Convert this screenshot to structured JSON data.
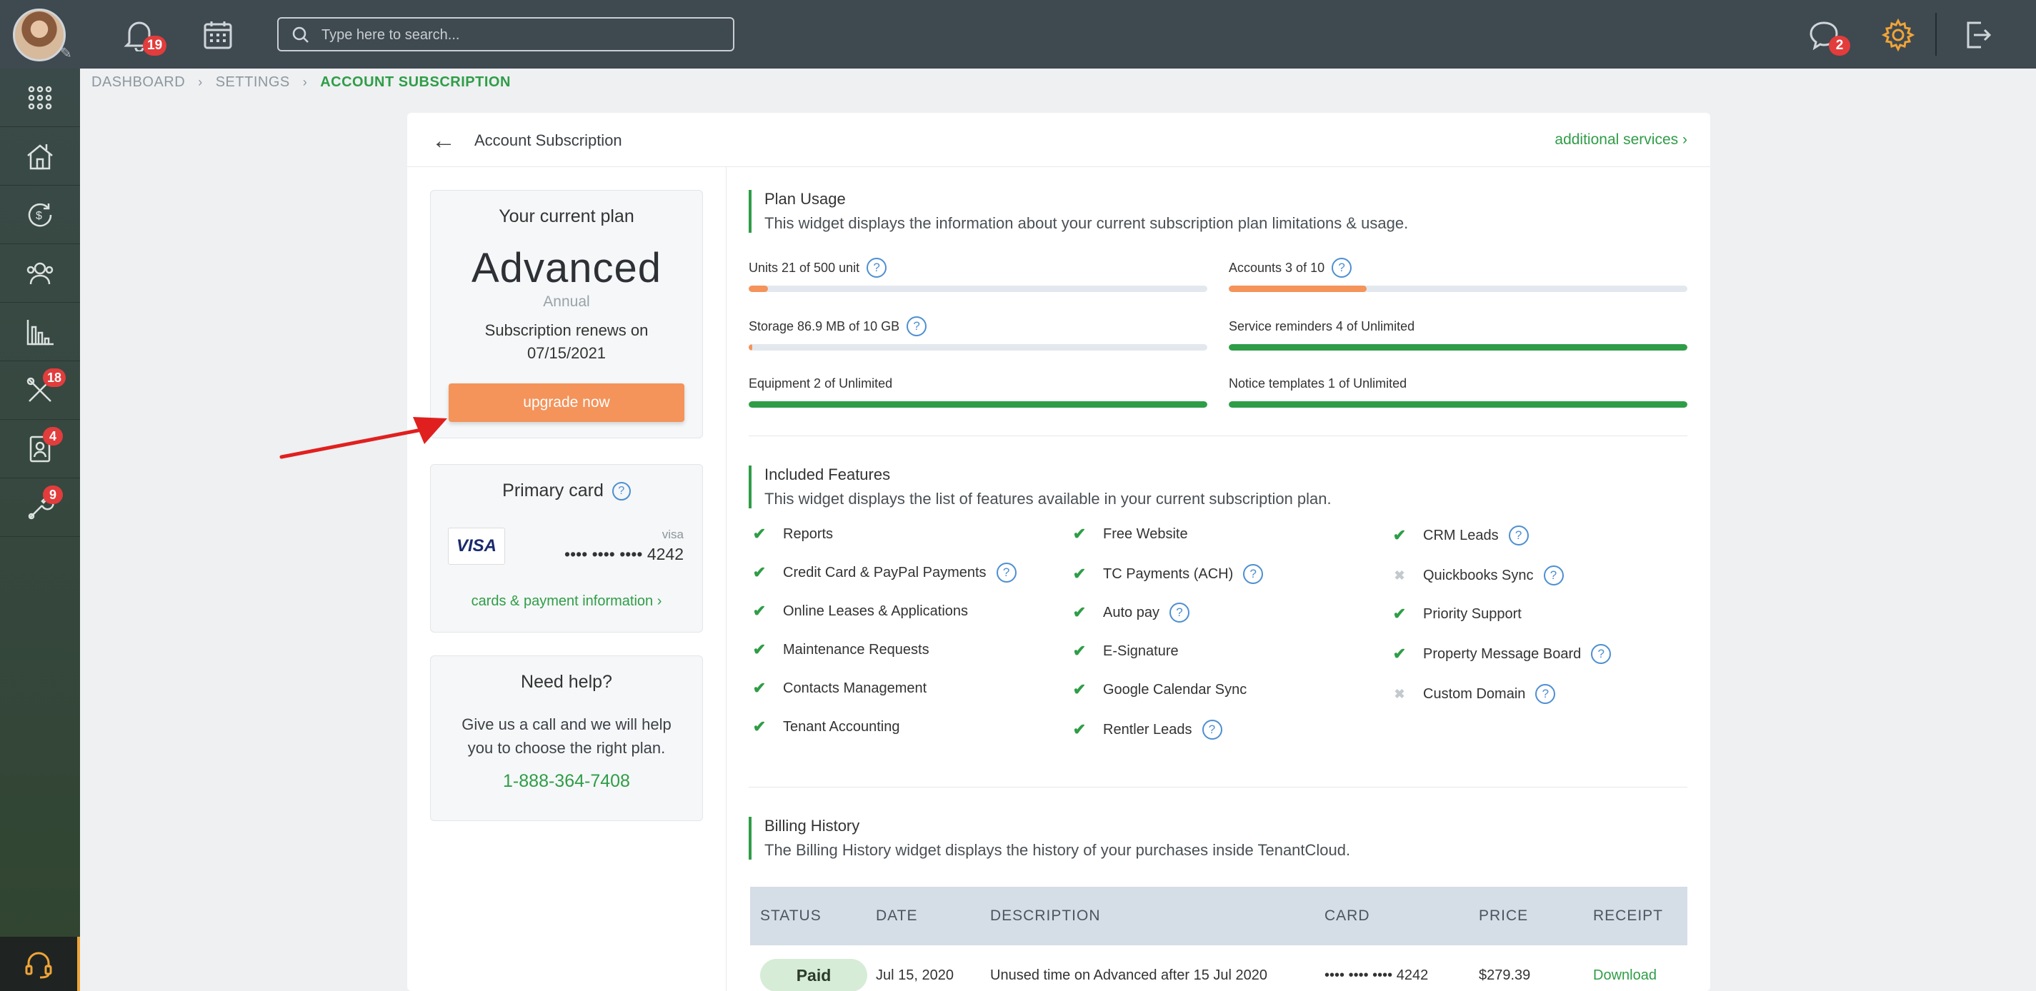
{
  "topbar": {
    "notifications_count": "19",
    "search_placeholder": "Type here to search...",
    "messages_count": "2"
  },
  "sidebar": {
    "items": [
      {
        "icon": "apps-grid-icon",
        "badge": ""
      },
      {
        "icon": "properties-icon",
        "badge": ""
      },
      {
        "icon": "accounting-icon",
        "badge": ""
      },
      {
        "icon": "contacts-icon",
        "badge": ""
      },
      {
        "icon": "reports-chart-icon",
        "badge": ""
      },
      {
        "icon": "maintenance-tools-icon",
        "badge": "18"
      },
      {
        "icon": "applications-icon",
        "badge": "4"
      },
      {
        "icon": "tools-icon",
        "badge": "9"
      }
    ]
  },
  "breadcrumb": {
    "items": [
      "DASHBOARD",
      "SETTINGS",
      "ACCOUNT SUBSCRIPTION"
    ]
  },
  "page": {
    "title": "Account Subscription",
    "additional_services": "additional services"
  },
  "plan": {
    "heading": "Your current plan",
    "name": "Advanced",
    "period": "Annual",
    "renew_label": "Subscription renews on",
    "renew_date": "07/15/2021",
    "upgrade_label": "upgrade now"
  },
  "card": {
    "heading": "Primary card",
    "brand_logo": "VISA",
    "brand": "visa",
    "number": "•••• •••• •••• 4242",
    "link": "cards & payment information"
  },
  "help": {
    "heading": "Need help?",
    "text": "Give us a call and we will help you to choose the right plan.",
    "phone": "1-888-364-7408"
  },
  "usage": {
    "title": "Plan Usage",
    "desc": "This widget displays the information about your current subscription plan limitations & usage.",
    "items": [
      {
        "label": "Units 21 of 500 unit",
        "pct": 4.2,
        "color": "#f4935a",
        "help": true
      },
      {
        "label": "Accounts 3 of 10",
        "pct": 30,
        "color": "#f4935a",
        "help": true
      },
      {
        "label": "Storage 86.9 MB of 10 GB",
        "pct": 0.8,
        "color": "#f4935a",
        "help": true
      },
      {
        "label": "Service reminders 4 of Unlimited",
        "pct": 100,
        "color": "#2f9d47",
        "help": false
      },
      {
        "label": "Equipment 2 of Unlimited",
        "pct": 100,
        "color": "#2f9d47",
        "help": false
      },
      {
        "label": "Notice templates 1 of Unlimited",
        "pct": 100,
        "color": "#2f9d47",
        "help": false
      }
    ]
  },
  "features": {
    "title": "Included Features",
    "desc": "This widget displays the list of features available in your current subscription plan.",
    "col1": [
      {
        "label": "Reports",
        "on": true,
        "help": false
      },
      {
        "label": "Credit Card & PayPal Payments",
        "on": true,
        "help": true
      },
      {
        "label": "Online Leases & Applications",
        "on": true,
        "help": false
      },
      {
        "label": "Maintenance Requests",
        "on": true,
        "help": false
      },
      {
        "label": "Contacts Management",
        "on": true,
        "help": false
      },
      {
        "label": "Tenant Accounting",
        "on": true,
        "help": false
      }
    ],
    "col2": [
      {
        "label": "Free Website",
        "on": true,
        "help": false
      },
      {
        "label": "TC Payments (ACH)",
        "on": true,
        "help": true
      },
      {
        "label": "Auto pay",
        "on": true,
        "help": true
      },
      {
        "label": "E-Signature",
        "on": true,
        "help": false
      },
      {
        "label": "Google Calendar Sync",
        "on": true,
        "help": false
      },
      {
        "label": "Rentler Leads",
        "on": true,
        "help": true
      }
    ],
    "col3": [
      {
        "label": "CRM Leads",
        "on": true,
        "help": true
      },
      {
        "label": "Quickbooks Sync",
        "on": false,
        "help": true
      },
      {
        "label": "Priority Support",
        "on": true,
        "help": false
      },
      {
        "label": "Property Message Board",
        "on": true,
        "help": true
      },
      {
        "label": "Custom Domain",
        "on": false,
        "help": true
      }
    ]
  },
  "billing": {
    "title": "Billing History",
    "desc": "The Billing History widget displays the history of your purchases inside TenantCloud.",
    "columns": [
      "STATUS",
      "DATE",
      "DESCRIPTION",
      "CARD",
      "PRICE",
      "RECEIPT"
    ],
    "rows": [
      {
        "status": "Paid",
        "date": "Jul 15, 2020",
        "description": "Unused time on Advanced after 15 Jul 2020",
        "card": "•••• •••• •••• 4242",
        "price": "$279.39",
        "receipt": "Download"
      }
    ]
  },
  "colors": {
    "accent": "#2f9d47",
    "upgrade": "#f4935a",
    "topbar": "#3f4950",
    "annotation_arrow": "#e0201f"
  }
}
